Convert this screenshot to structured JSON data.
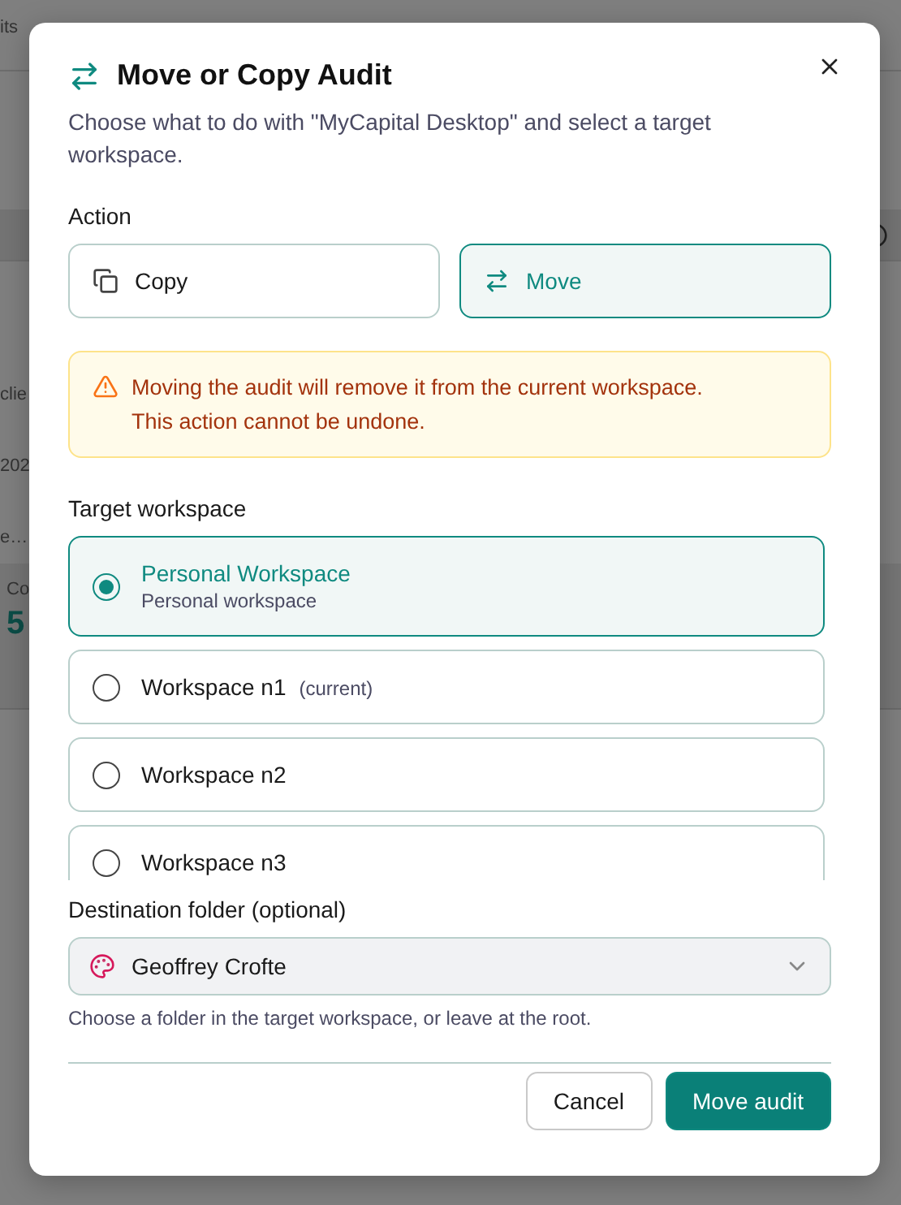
{
  "background": {
    "top_fragment": "its",
    "left_fragments": [
      "clie",
      "202",
      "e…"
    ],
    "card_label": "Co",
    "card_value": "5"
  },
  "dialog": {
    "title": "Move or Copy Audit",
    "description": "Choose what to do with \"MyCapital Desktop\" and select a target workspace.",
    "action": {
      "label": "Action",
      "options": [
        {
          "kind": "copy",
          "label": "Copy",
          "selected": false
        },
        {
          "kind": "move",
          "label": "Move",
          "selected": true
        }
      ]
    },
    "warning": [
      "Moving the audit will remove it from the current workspace.",
      "This action cannot be undone."
    ],
    "target": {
      "label": "Target workspace",
      "workspaces": [
        {
          "name": "Personal Workspace",
          "subtitle": "Personal workspace",
          "selected": true
        },
        {
          "name": "Workspace n1",
          "note": "(current)",
          "selected": false
        },
        {
          "name": "Workspace n2",
          "selected": false
        },
        {
          "name": "Workspace n3",
          "selected": false
        }
      ]
    },
    "destination": {
      "label": "Destination folder (optional)",
      "value": "Geoffrey Crofte",
      "hint": "Choose a folder in the target workspace, or leave at the root."
    },
    "buttons": [
      {
        "kind": "secondary",
        "label": "Cancel"
      },
      {
        "kind": "primary",
        "label": "Move audit"
      }
    ]
  }
}
